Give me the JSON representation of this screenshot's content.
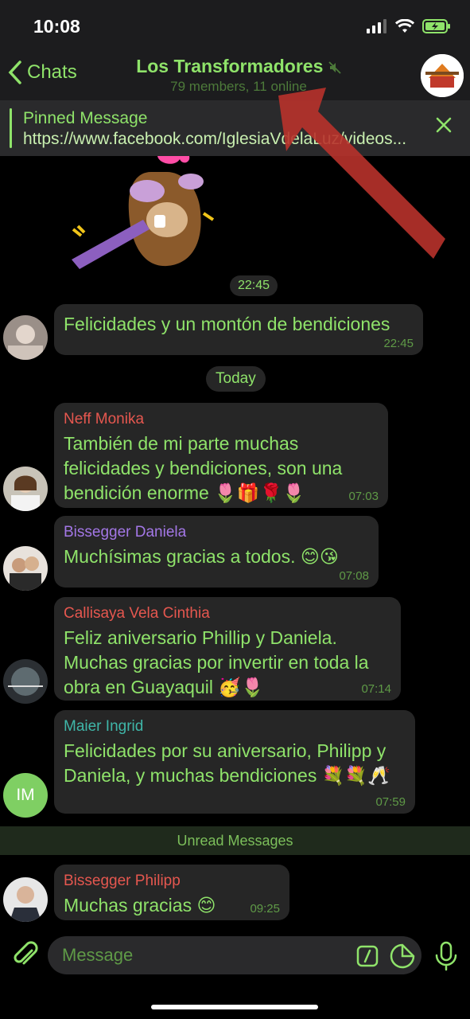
{
  "status_bar": {
    "time": "10:08"
  },
  "nav": {
    "back_label": "Chats",
    "title": "Los Transformadores",
    "subtitle": "79 members, 11 online"
  },
  "pinned": {
    "title": "Pinned Message",
    "link": "https://www.facebook.com/IglesiaVdelaLuz/videos..."
  },
  "sticker_time": "22:45",
  "date_separator": "Today",
  "unread_label": "Unread Messages",
  "messages": [
    {
      "sender": "",
      "text": "Felicidades y un montón de bendiciones",
      "time": "22:45"
    },
    {
      "sender": "Neff Monika",
      "sender_color": "#e5574f",
      "text": "También de mi parte muchas felicidades y bendiciones, son una bendición enorme 🌷🎁🌹🌷",
      "time": "07:03"
    },
    {
      "sender": "Bissegger Daniela",
      "sender_color": "#a377e6",
      "text": "Muchísimas gracias a todos. 😊😘",
      "time": "07:08"
    },
    {
      "sender": "Callisaya Vela Cinthia",
      "sender_color": "#e5574f",
      "text": "Feliz aniversario Phillip y Daniela. Muchas gracias por invertir en toda la obra en Guayaquil 🥳🌷",
      "time": "07:14"
    },
    {
      "sender": "Maier Ingrid",
      "sender_color": "#3fb6a8",
      "text": "Felicidades por su aniversario, Philipp y Daniela, y muchas bendiciones 💐💐🥂",
      "time": "07:59",
      "avatar_initials": "IM"
    },
    {
      "sender": "Bissegger Philipp",
      "sender_color": "#e5574f",
      "text": "Muchas gracias 😊",
      "time": "09:25"
    }
  ],
  "input": {
    "placeholder": "Message"
  },
  "colors": {
    "accent": "#8fe36a",
    "bubble": "#262626",
    "background": "#000000"
  }
}
